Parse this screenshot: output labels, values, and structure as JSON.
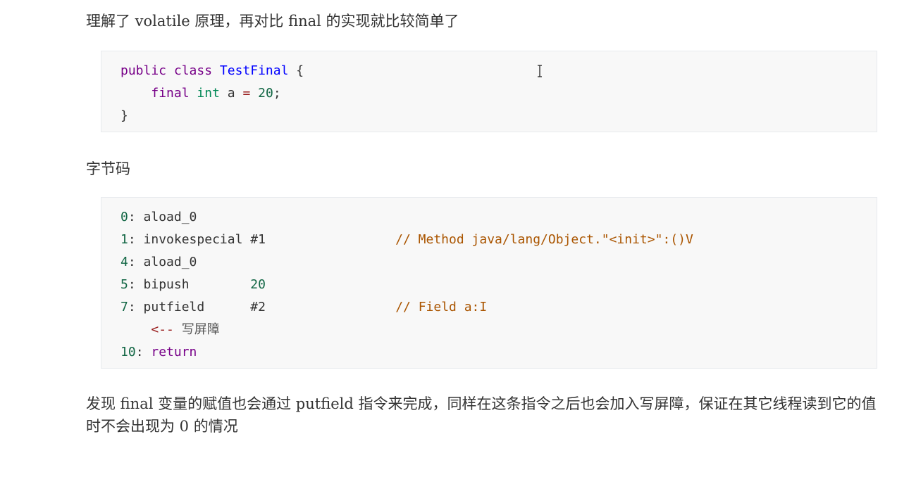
{
  "intro_text": "理解了 volatile 原理，再对比 final 的实现就比较简单了",
  "java_code": {
    "kw_public": "public",
    "kw_class": "class",
    "class_name": "TestFinal",
    "open_brace": "{",
    "kw_final": "final",
    "kw_int": "int",
    "var_name": "a",
    "assign_op": "=",
    "value": "20",
    "semicolon": ";",
    "close_brace": "}"
  },
  "bytecode_heading": "字节码",
  "bytecode": {
    "l0_idx": "0",
    "l0_instr": "aload_0",
    "l1_idx": "1",
    "l1_instr": "invokespecial #1",
    "l1_comment": "// Method java/lang/Object.\"<init>\":()V",
    "l2_idx": "4",
    "l2_instr": "aload_0",
    "l3_idx": "5",
    "l3_instr": "bipush",
    "l3_arg": "20",
    "l4_idx": "7",
    "l4_instr": "putfield",
    "l4_arg": "#2",
    "l4_comment": "// Field a:I",
    "barrier_arrow": "<--",
    "barrier_text": "写屏障",
    "l5_idx": "10",
    "l5_instr": "return"
  },
  "conclusion_text": "发现 final 变量的赋值也会通过 putfield 指令来完成，同样在这条指令之后也会加入写屏障，保证在其它线程读到它的值时不会出现为 0 的情况",
  "icons": {
    "cursor": "text-cursor-icon"
  }
}
